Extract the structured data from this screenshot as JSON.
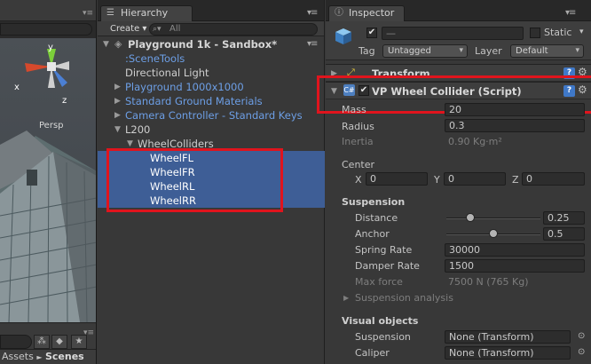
{
  "scene": {
    "gizmo_y": "y",
    "gizmo_x": "x",
    "gizmo_z": "z",
    "persp_label": "Persp",
    "breadcrumb_assets": "Assets",
    "breadcrumb_sep": "►",
    "breadcrumb_scenes": "Scenes"
  },
  "hierarchy": {
    "tab_label": "Hierarchy",
    "create_label": "Create ▾",
    "search_placeholder": "All",
    "root": "Playground 1k - Sandbox*",
    "items": [
      {
        "label": ":SceneTools",
        "color": "blue"
      },
      {
        "label": "Directional Light",
        "color": "white"
      },
      {
        "label": "Playground 1000x1000",
        "color": "blue"
      },
      {
        "label": "Standard Ground Materials",
        "color": "blue"
      },
      {
        "label": "Camera Controller - Standard Keys",
        "color": "blue"
      },
      {
        "label": "L200",
        "color": "white"
      },
      {
        "label": "WheelColliders",
        "color": "white"
      },
      {
        "label": "WheelFL",
        "color": "white"
      },
      {
        "label": "WheelFR",
        "color": "white"
      },
      {
        "label": "WheelRL",
        "color": "white"
      },
      {
        "label": "WheelRR",
        "color": "white"
      }
    ]
  },
  "inspector": {
    "tab_label": "Inspector",
    "object_name": "—",
    "static_label": "Static",
    "tag_label": "Tag",
    "tag_value": "Untagged",
    "layer_label": "Layer",
    "layer_value": "Default",
    "transform_title": "Transform",
    "component_title": "VP Wheel Collider (Script)",
    "mass_label": "Mass",
    "mass_value": "20",
    "radius_label": "Radius",
    "radius_value": "0.3",
    "inertia_label": "Inertia",
    "inertia_value": "0.90 Kg·m²",
    "center_label": "Center",
    "center_x_label": "X",
    "center_x": "0",
    "center_y_label": "Y",
    "center_y": "0",
    "center_z_label": "Z",
    "center_z": "0",
    "suspension_header": "Suspension",
    "distance_label": "Distance",
    "distance_value": "0.25",
    "distance_fraction": 0.25,
    "anchor_label": "Anchor",
    "anchor_value": "0.5",
    "anchor_fraction": 0.5,
    "spring_label": "Spring Rate",
    "spring_value": "30000",
    "damper_label": "Damper Rate",
    "damper_value": "1500",
    "maxforce_label": "Max force",
    "maxforce_value": "7500 N  (765 Kg)",
    "analysis_label": "Suspension analysis",
    "visual_header": "Visual objects",
    "vis_suspension_label": "Suspension",
    "vis_suspension_value": "None (Transform)",
    "vis_caliper_label": "Caliper",
    "vis_caliper_value": "None (Transform)"
  },
  "colors": {
    "selection": "#3e5e96",
    "prefab_blue": "#6d9fe6",
    "highlight_red": "#e0141d"
  }
}
